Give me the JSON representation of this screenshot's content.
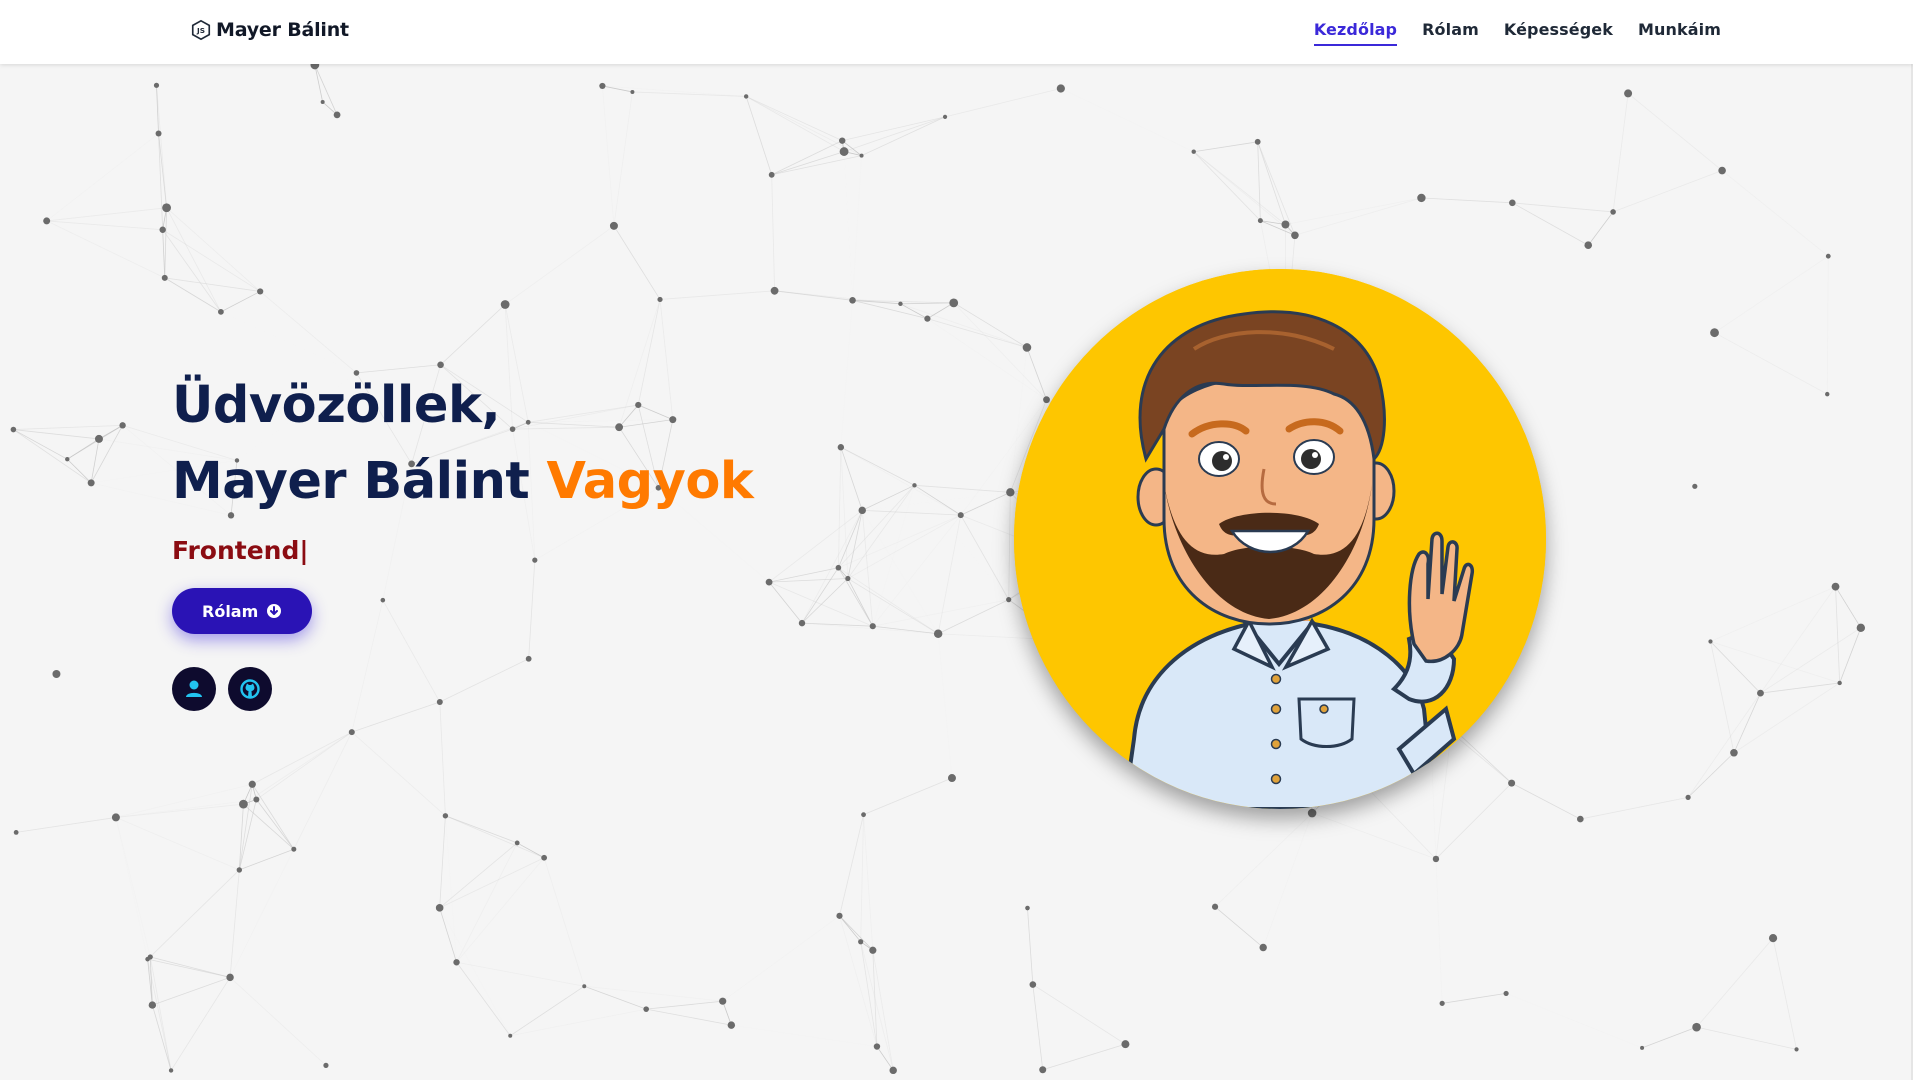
{
  "header": {
    "brand_name": "Mayer Bálint",
    "brand_icon": "nodejs-logo-icon",
    "nav_items": [
      {
        "label": "Kezdőlap",
        "active": true
      },
      {
        "label": "Rólam",
        "active": false
      },
      {
        "label": "Képességek",
        "active": false
      },
      {
        "label": "Munkáim",
        "active": false
      }
    ]
  },
  "hero": {
    "greeting": "Üdvözöllek,",
    "name": "Mayer Bálint",
    "name_suffix": "Vagyok",
    "typed_role": "Frontend|",
    "cta_label": "Rólam",
    "cta_icon": "arrow-down-circle-icon",
    "social_icons": [
      "user-icon",
      "github-icon"
    ]
  },
  "avatar": {
    "icon": "bitmoji-avatar-waving"
  },
  "colors": {
    "accent_orange": "#ff7a00",
    "heading_navy": "#0f1f4d",
    "role_red": "#8b0c12",
    "button_blue": "#2a13b5",
    "nav_active": "#3b29d9",
    "avatar_bg": "#fec600"
  }
}
